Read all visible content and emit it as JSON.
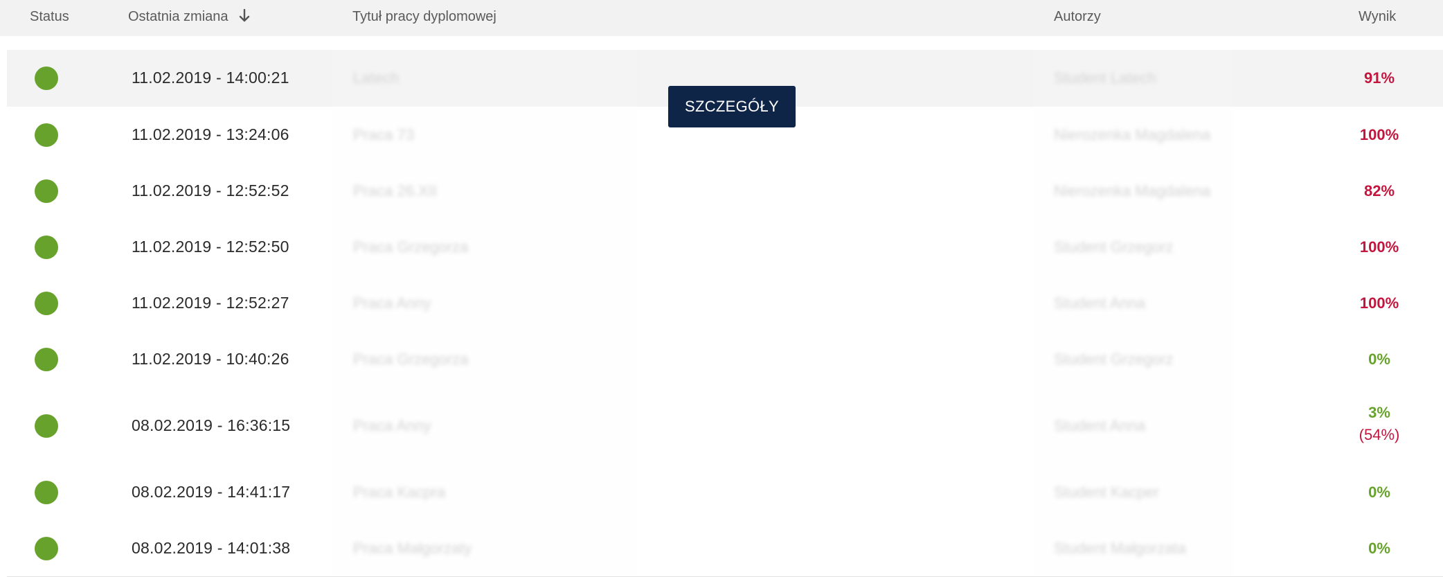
{
  "headers": {
    "status": "Status",
    "last_change": "Ostatnia zmiana",
    "title": "Tytuł pracy dyplomowej",
    "authors": "Autorzy",
    "result": "Wynik"
  },
  "details_button": "SZCZEGÓŁY",
  "colors": {
    "status_ok": "#67a32c",
    "score_high": "#c2163e",
    "score_low": "#67a32c",
    "button_bg": "#0f2547"
  },
  "rows": [
    {
      "date": "11.02.2019 - 14:00:21",
      "title": "Latech",
      "author": "Student Latech",
      "score": "91%",
      "score_sub": "",
      "score_color": "red"
    },
    {
      "date": "11.02.2019 - 13:24:06",
      "title": "Praca 73",
      "author": "Nierozenka Magdalena",
      "score": "100%",
      "score_sub": "",
      "score_color": "red"
    },
    {
      "date": "11.02.2019 - 12:52:52",
      "title": "Praca 26.XII",
      "author": "Nierozenka Magdalena",
      "score": "82%",
      "score_sub": "",
      "score_color": "red"
    },
    {
      "date": "11.02.2019 - 12:52:50",
      "title": "Praca Grzegorza",
      "author": "Student Grzegorz",
      "score": "100%",
      "score_sub": "",
      "score_color": "red"
    },
    {
      "date": "11.02.2019 - 12:52:27",
      "title": "Praca Anny",
      "author": "Student Anna",
      "score": "100%",
      "score_sub": "",
      "score_color": "red"
    },
    {
      "date": "11.02.2019 - 10:40:26",
      "title": "Praca Grzegorza",
      "author": "Student Grzegorz",
      "score": "0%",
      "score_sub": "",
      "score_color": "green"
    },
    {
      "date": "08.02.2019 - 16:36:15",
      "title": "Praca Anny",
      "author": "Student Anna",
      "score": "3%",
      "score_sub": "(54%)",
      "score_color": "green"
    },
    {
      "date": "08.02.2019 - 14:41:17",
      "title": "Praca Kacpra",
      "author": "Student Kacper",
      "score": "0%",
      "score_sub": "",
      "score_color": "green"
    },
    {
      "date": "08.02.2019 - 14:01:38",
      "title": "Praca Małgorzaty",
      "author": "Student Małgorzata",
      "score": "0%",
      "score_sub": "",
      "score_color": "green"
    }
  ]
}
